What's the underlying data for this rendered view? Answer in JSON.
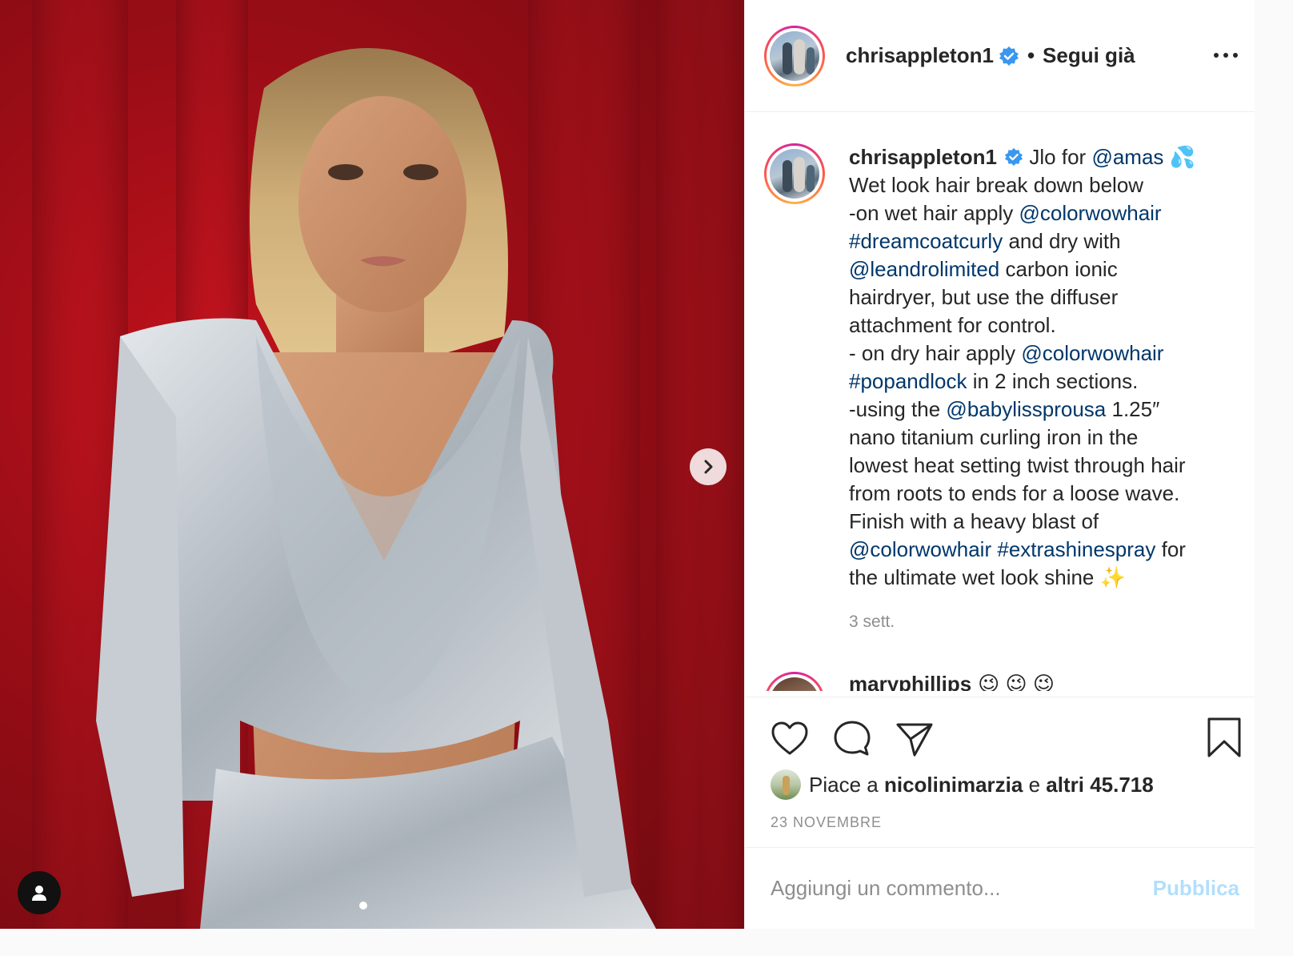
{
  "post": {
    "author": "chrisappleton1",
    "follow_separator": "•",
    "follow_status": "Segui già",
    "caption": {
      "line1_text": "Jlo for",
      "line1_mention": "@amas",
      "line1_emoji": "💦",
      "line2": "Wet look hair break down below",
      "line3_text": "-on wet hair apply",
      "line3_mention": "@colorwowhair",
      "line4_tag": "#dreamcoatcurly",
      "line4_text": "and dry with",
      "line5_mention": "@leandrolimited",
      "line5_text": "carbon ionic",
      "line6": "hairdryer, but use the diffuser",
      "line7": "attachment for control.",
      "line8_text": "- on dry hair apply",
      "line8_mention": "@colorwowhair",
      "line9_tag": "#popandlock",
      "line9_text": "in 2 inch sections.",
      "line10_text": "-using the",
      "line10_mention": "@babylissprousa",
      "line10_tail": "1.25″",
      "line11": "nano titanium curling iron in the",
      "line12": "lowest heat setting twist through hair",
      "line13": "from roots to ends for a loose wave.",
      "line14": "Finish with a heavy blast of",
      "line15_mention": "@colorwowhair",
      "line15_tag": "#extrashinespray",
      "line15_text": "for",
      "line16_text": "the ultimate wet look shine",
      "line16_emoji": "✨",
      "time": "3 sett."
    },
    "next_comment": {
      "author": "maryphillips",
      "emojis": "😉 😉 😉"
    },
    "likes": {
      "prefix": "Piace a",
      "liker": "nicolinimarzia",
      "joiner": "e",
      "others": "altri 45.718"
    },
    "date": "23 NOVEMBRE",
    "comment_placeholder": "Aggiungi un commento...",
    "post_button": "Pubblica"
  },
  "colors": {
    "link": "#00376b",
    "verified": "#3897f0",
    "post_disabled": "#b2dffc",
    "photo_background": "#b3131d"
  },
  "icons": [
    "chevron-right-icon",
    "user-tag-icon",
    "verified-badge-icon",
    "more-icon",
    "heart-icon",
    "comment-icon",
    "share-icon",
    "bookmark-icon"
  ]
}
